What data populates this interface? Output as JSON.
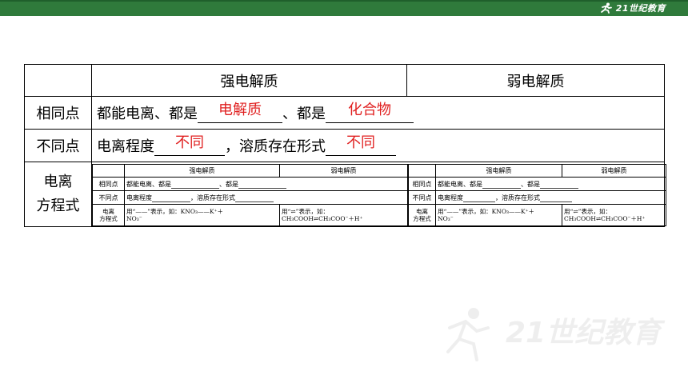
{
  "brand": {
    "logo_text": "21世纪教育",
    "colors": {
      "bar": "#2f7a3b",
      "answer": "#e02020"
    }
  },
  "table": {
    "headers": [
      "强电解质",
      "弱电解质"
    ],
    "row_same": {
      "label": "相同点",
      "text_a": "都能电离、都是",
      "text_b": "、都是",
      "answer_1": "电解质",
      "answer_2": "化合物"
    },
    "row_diff": {
      "label": "不同点",
      "text_a": "电离程度",
      "text_b": "，溶质存在形式",
      "answer_1": "不同",
      "answer_2": "不同"
    },
    "row_eq": {
      "label_line1": "电离",
      "label_line2": "方程式"
    }
  },
  "mini_table": {
    "headers": [
      "强电解质",
      "弱电解质"
    ],
    "same_label": "相同点",
    "same_a": "都能电离、都是",
    "same_b": "、都是",
    "diff_label": "不同点",
    "diff_a": "电离程度",
    "diff_b": "，溶质存在形式",
    "eq_label_1": "电离",
    "eq_label_2": "方程式",
    "strong_eq_1": "用“——”表示，如：KNO₃——K⁺＋",
    "strong_eq_2": "NO₃⁻",
    "weak_eq_1": "用“⇌”表示，如：",
    "weak_eq_2": "CH₃COOH⇌CH₃COO⁻＋H⁺"
  },
  "watermark_text": "21世纪教育"
}
